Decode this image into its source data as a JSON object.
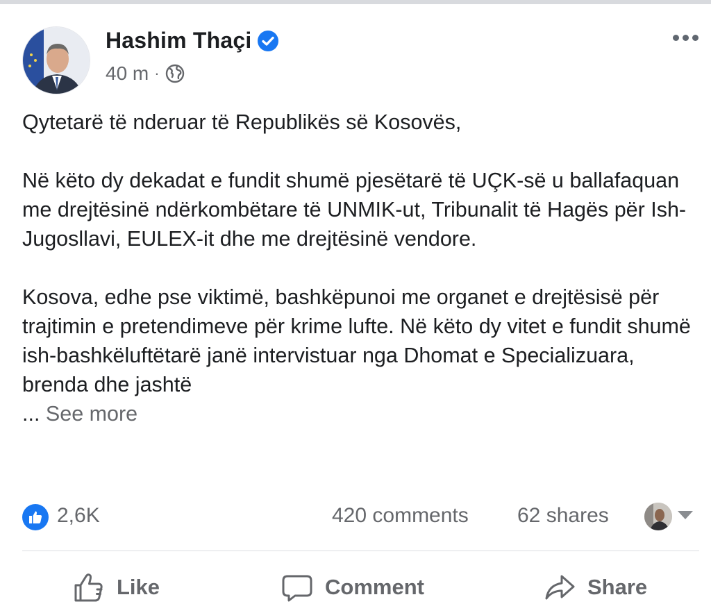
{
  "post": {
    "author": "Hashim Thaçi",
    "time": "40 m",
    "separator": "·",
    "paragraphs": [
      "Qytetarë të nderuar të Republikës së Kosovës,",
      "Në këto dy dekadat e fundit shumë pjesëtarë të UÇK-së u ballafaquan me drejtësinë ndërkombëtare të UNMIK-ut, Tribunalit të Hagës për Ish-Jugosllavi, EULEX-it dhe me drejtësinë vendore.",
      "Kosova, edhe pse viktimë, bashkëpunoi me organet e drejtësisë për trajtimin e pretendimeve për krime lufte. Në këto dy vitet e fundit shumë ish-bashkëluftëtarë janë intervistuar nga Dhomat e Specializuara, brenda dhe jashtë"
    ],
    "ellipsis": "... ",
    "see_more": "See more"
  },
  "stats": {
    "reactions": "2,6K",
    "comments": "420 comments",
    "shares": "62 shares"
  },
  "actions": {
    "like": "Like",
    "comment": "Comment",
    "share": "Share"
  },
  "icons": {
    "verified": "verified-badge-icon",
    "privacy": "globe-icon",
    "menu": "more-options-icon",
    "reaction": "like-reaction-icon",
    "like": "thumbs-up-icon",
    "comment": "speech-bubble-icon",
    "share": "share-arrow-icon"
  },
  "colors": {
    "brand_blue": "#1877f2",
    "secondary_text": "#65676b",
    "primary_text": "#1c1e21"
  }
}
